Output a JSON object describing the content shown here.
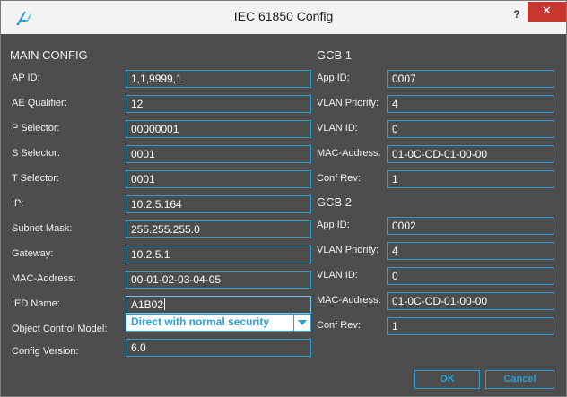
{
  "window": {
    "title": "IEC 61850 Config",
    "help_label": "?",
    "close_label": "✕",
    "accent_color": "#2a9fd8",
    "close_color": "#c7372f"
  },
  "main_config": {
    "heading": "MAIN CONFIG",
    "ap_id": {
      "label": "AP ID:",
      "value": "1,1,9999,1"
    },
    "ae_qualifier": {
      "label": "AE Qualifier:",
      "value": "12"
    },
    "p_selector": {
      "label": "P Selector:",
      "value": "00000001"
    },
    "s_selector": {
      "label": "S Selector:",
      "value": "0001"
    },
    "t_selector": {
      "label": "T Selector:",
      "value": "0001"
    },
    "ip": {
      "label": "IP:",
      "value": "10.2.5.164"
    },
    "subnet_mask": {
      "label": "Subnet Mask:",
      "value": "255.255.255.0"
    },
    "gateway": {
      "label": "Gateway:",
      "value": "10.2.5.1"
    },
    "mac_address": {
      "label": "MAC-Address:",
      "value": "00-01-02-03-04-05"
    },
    "ied_name": {
      "label": "IED Name:",
      "value": "A1B02"
    },
    "object_control_model": {
      "label": "Object Control Model:",
      "value": "Direct with normal security"
    },
    "config_version": {
      "label": "Config Version:",
      "value": "6.0"
    }
  },
  "gcb1": {
    "heading": "GCB 1",
    "app_id": {
      "label": "App ID:",
      "value": "0007"
    },
    "vlan_priority": {
      "label": "VLAN Priority:",
      "value": "4"
    },
    "vlan_id": {
      "label": "VLAN ID:",
      "value": "0"
    },
    "mac_address": {
      "label": "MAC-Address:",
      "value": "01-0C-CD-01-00-00"
    },
    "conf_rev": {
      "label": "Conf Rev:",
      "value": "1"
    }
  },
  "gcb2": {
    "heading": "GCB 2",
    "app_id": {
      "label": "App ID:",
      "value": "0002"
    },
    "vlan_priority": {
      "label": "VLAN Priority:",
      "value": "4"
    },
    "vlan_id": {
      "label": "VLAN ID:",
      "value": "0"
    },
    "mac_address": {
      "label": "MAC-Address:",
      "value": "01-0C-CD-01-00-00"
    },
    "conf_rev": {
      "label": "Conf Rev:",
      "value": "1"
    }
  },
  "buttons": {
    "ok": "OK",
    "cancel": "Cancel"
  },
  "icons": {
    "app": "app-logo-icon",
    "dropdown": "chevron-down-icon"
  }
}
